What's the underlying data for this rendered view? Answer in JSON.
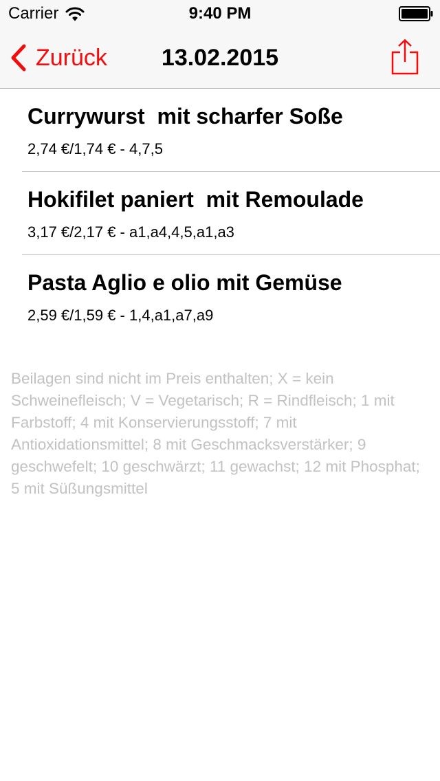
{
  "status_bar": {
    "carrier": "Carrier",
    "time": "9:40 PM",
    "wifi_icon": "wifi-icon",
    "battery_icon": "battery-icon"
  },
  "nav": {
    "back_label": "Zurück",
    "title": "13.02.2015",
    "share_icon": "share-icon",
    "accent_color": "#f40c0c"
  },
  "menu": {
    "items": [
      {
        "title": "Currywurst  mit scharfer Soße",
        "subtitle": "2,74 €/1,74 € - 4,7,5"
      },
      {
        "title": "Hokifilet paniert  mit Remoulade",
        "subtitle": "3,17 €/2,17 € - a1,a4,4,5,a1,a3"
      },
      {
        "title": "Pasta Aglio e olio mit Gemüse",
        "subtitle": "2,59 €/1,59 € - 1,4,a1,a7,a9"
      }
    ]
  },
  "legend": {
    "text": "Beilagen sind nicht im Preis enthalten; X = kein Schweinefleisch; V = Vegetarisch; R = Rindfleisch; 1 mit Farbstoff; 4 mit Konservierungsstoff; 7 mit Antioxidationsmittel; 8 mit Geschmacksverstärker; 9 geschwefelt; 10 geschwärzt; 11 gewachst; 12 mit Phosphat; 5 mit Süßungsmittel"
  }
}
